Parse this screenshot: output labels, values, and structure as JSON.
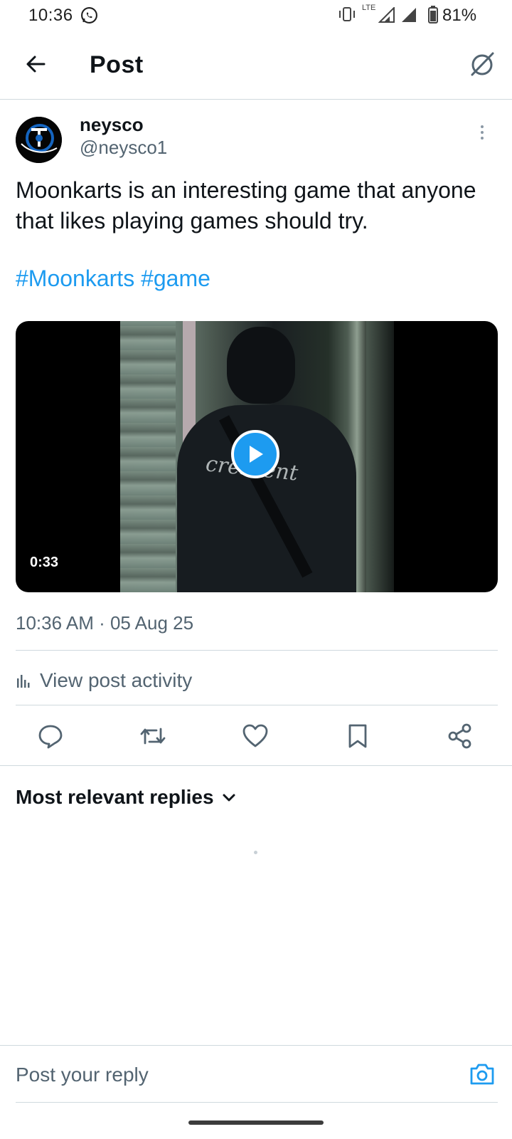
{
  "status_bar": {
    "time": "10:36",
    "network": "LTE",
    "battery": "81%"
  },
  "header": {
    "title": "Post"
  },
  "post": {
    "display_name": "neysco",
    "handle": "@neysco1",
    "text": "Moonkarts is an interesting game that anyone that likes playing games should try.",
    "hashtags": [
      "#Moonkarts",
      "#game"
    ],
    "video": {
      "duration": "0:33",
      "shirt_text": "crescent"
    },
    "timestamp": "10:36 AM · 05 Aug 25",
    "activity_label": "View post activity"
  },
  "actions": [
    {
      "name": "reply-button",
      "icon": "comment-icon"
    },
    {
      "name": "repost-button",
      "icon": "repost-icon"
    },
    {
      "name": "like-button",
      "icon": "heart-icon"
    },
    {
      "name": "bookmark-button",
      "icon": "bookmark-icon"
    },
    {
      "name": "share-button",
      "icon": "share-icon"
    }
  ],
  "replies": {
    "sort_label": "Most relevant replies"
  },
  "composer": {
    "placeholder": "Post your reply"
  },
  "colors": {
    "accent": "#1d9bf0",
    "secondary_text": "#536471",
    "divider": "#cfd9de"
  }
}
